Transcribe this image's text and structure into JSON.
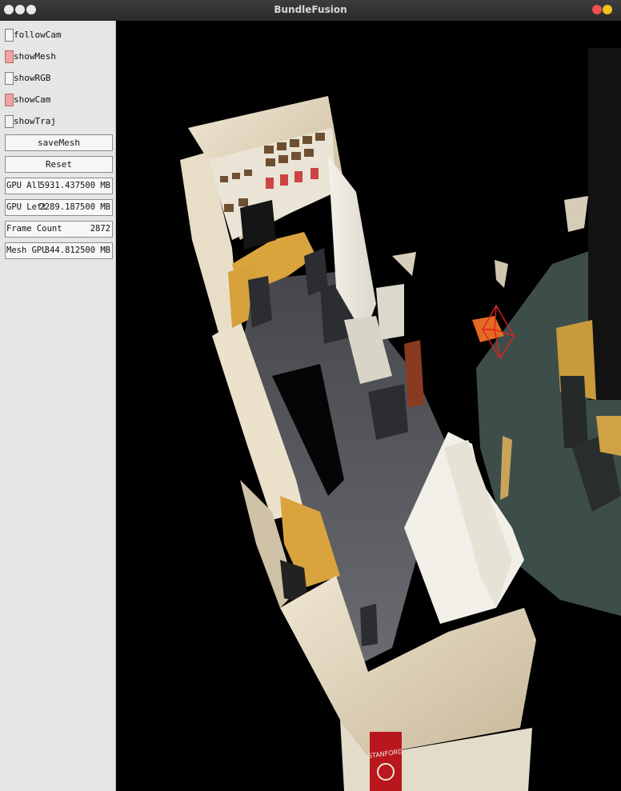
{
  "window": {
    "title": "BundleFusion"
  },
  "panel": {
    "toggles": [
      {
        "label": "followCam",
        "checked": false
      },
      {
        "label": "showMesh",
        "checked": true
      },
      {
        "label": "showRGB",
        "checked": false
      },
      {
        "label": "showCam",
        "checked": true
      },
      {
        "label": "showTraj",
        "checked": false
      }
    ],
    "buttons": {
      "save": "saveMesh",
      "reset": "Reset"
    },
    "stats": [
      {
        "key": "GPU All",
        "value": "5931.437500 MB"
      },
      {
        "key": "GPU Left",
        "value": "2289.187500 MB"
      },
      {
        "key": "Frame Count",
        "value": "2872"
      },
      {
        "key": "Mesh GPU",
        "value": "344.812500 MB"
      }
    ]
  },
  "scene": {
    "poster_text": "STANFORD",
    "colors": {
      "checked": "#f0a4a4",
      "camera_frustum": "#e02020",
      "close": "#ee4f4f",
      "minimize": "#f2c21a"
    }
  }
}
